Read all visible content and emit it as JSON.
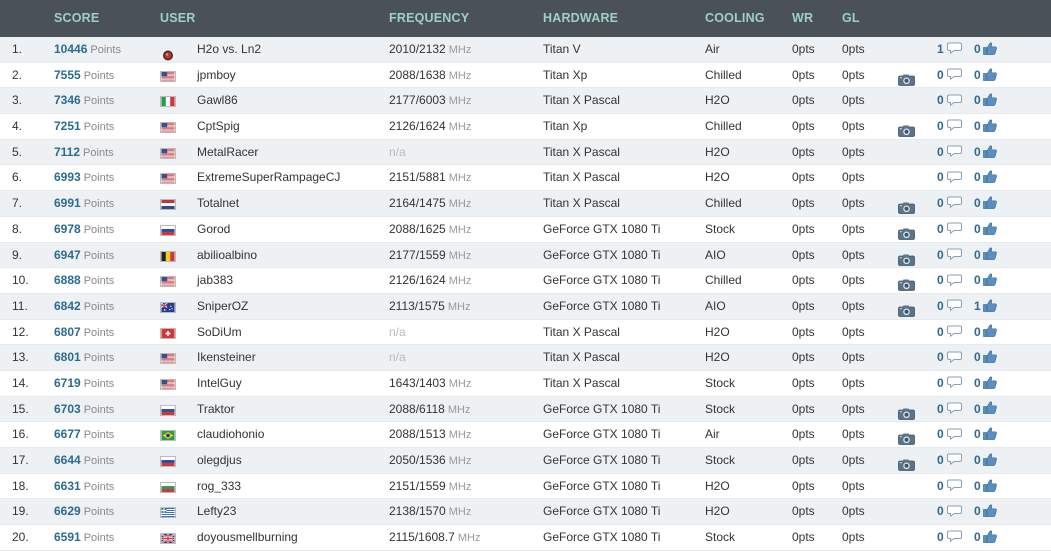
{
  "header": {
    "score": "SCORE",
    "user": "USER",
    "frequency": "FREQUENCY",
    "hardware": "HARDWARE",
    "cooling": "COOLING",
    "wr": "WR",
    "gl": "GL"
  },
  "units": {
    "points": "Points",
    "mhz": "MHz"
  },
  "colors": {
    "header_bg": "#4a5258",
    "header_text": "#9fd0c5",
    "score": "#2d6a8f",
    "row_alt": "#eef1f3"
  },
  "rows": [
    {
      "rank": "1.",
      "score": "10446",
      "flag": "ln2",
      "user": "H2o vs. Ln2",
      "freq": "2010/2132",
      "freq_na": false,
      "hardware": "Titan V",
      "cooling": "Air",
      "wr": "0pts",
      "gl": "0pts",
      "camera": false,
      "comments": "1",
      "likes": "0"
    },
    {
      "rank": "2.",
      "score": "7555",
      "flag": "us",
      "user": "jpmboy",
      "freq": "2088/1638",
      "freq_na": false,
      "hardware": "Titan Xp",
      "cooling": "Chilled",
      "wr": "0pts",
      "gl": "0pts",
      "camera": true,
      "comments": "0",
      "likes": "0"
    },
    {
      "rank": "3.",
      "score": "7346",
      "flag": "it",
      "user": "Gawl86",
      "freq": "2177/6003",
      "freq_na": false,
      "hardware": "Titan X Pascal",
      "cooling": "H2O",
      "wr": "0pts",
      "gl": "0pts",
      "camera": false,
      "comments": "0",
      "likes": "0"
    },
    {
      "rank": "4.",
      "score": "7251",
      "flag": "us",
      "user": "CptSpig",
      "freq": "2126/1624",
      "freq_na": false,
      "hardware": "Titan Xp",
      "cooling": "Chilled",
      "wr": "0pts",
      "gl": "0pts",
      "camera": true,
      "comments": "0",
      "likes": "0"
    },
    {
      "rank": "5.",
      "score": "7112",
      "flag": "us",
      "user": "MetalRacer",
      "freq": "n/a",
      "freq_na": true,
      "hardware": "Titan X Pascal",
      "cooling": "H2O",
      "wr": "0pts",
      "gl": "0pts",
      "camera": false,
      "comments": "0",
      "likes": "0"
    },
    {
      "rank": "6.",
      "score": "6993",
      "flag": "us",
      "user": "ExtremeSuperRampageCJ",
      "freq": "2151/5881",
      "freq_na": false,
      "hardware": "Titan X Pascal",
      "cooling": "H2O",
      "wr": "0pts",
      "gl": "0pts",
      "camera": false,
      "comments": "0",
      "likes": "0"
    },
    {
      "rank": "7.",
      "score": "6991",
      "flag": "nl",
      "user": "Totalnet",
      "freq": "2164/1475",
      "freq_na": false,
      "hardware": "Titan X Pascal",
      "cooling": "Chilled",
      "wr": "0pts",
      "gl": "0pts",
      "camera": true,
      "comments": "0",
      "likes": "0"
    },
    {
      "rank": "8.",
      "score": "6978",
      "flag": "ru",
      "user": "Gorod",
      "freq": "2088/1625",
      "freq_na": false,
      "hardware": "GeForce GTX 1080 Ti",
      "cooling": "Stock",
      "wr": "0pts",
      "gl": "0pts",
      "camera": true,
      "comments": "0",
      "likes": "0"
    },
    {
      "rank": "9.",
      "score": "6947",
      "flag": "be",
      "user": "abilioalbino",
      "freq": "2177/1559",
      "freq_na": false,
      "hardware": "GeForce GTX 1080 Ti",
      "cooling": "AIO",
      "wr": "0pts",
      "gl": "0pts",
      "camera": true,
      "comments": "0",
      "likes": "0"
    },
    {
      "rank": "10.",
      "score": "6888",
      "flag": "us",
      "user": "jab383",
      "freq": "2126/1624",
      "freq_na": false,
      "hardware": "GeForce GTX 1080 Ti",
      "cooling": "Chilled",
      "wr": "0pts",
      "gl": "0pts",
      "camera": true,
      "comments": "0",
      "likes": "0"
    },
    {
      "rank": "11.",
      "score": "6842",
      "flag": "au",
      "user": "SniperOZ",
      "freq": "2113/1575",
      "freq_na": false,
      "hardware": "GeForce GTX 1080 Ti",
      "cooling": "AIO",
      "wr": "0pts",
      "gl": "0pts",
      "camera": true,
      "comments": "0",
      "likes": "1"
    },
    {
      "rank": "12.",
      "score": "6807",
      "flag": "ch",
      "user": "SoDiUm",
      "freq": "n/a",
      "freq_na": true,
      "hardware": "Titan X Pascal",
      "cooling": "H2O",
      "wr": "0pts",
      "gl": "0pts",
      "camera": false,
      "comments": "0",
      "likes": "0"
    },
    {
      "rank": "13.",
      "score": "6801",
      "flag": "us",
      "user": "Ikensteiner",
      "freq": "n/a",
      "freq_na": true,
      "hardware": "Titan X Pascal",
      "cooling": "H2O",
      "wr": "0pts",
      "gl": "0pts",
      "camera": false,
      "comments": "0",
      "likes": "0"
    },
    {
      "rank": "14.",
      "score": "6719",
      "flag": "us",
      "user": "IntelGuy",
      "freq": "1643/1403",
      "freq_na": false,
      "hardware": "Titan X Pascal",
      "cooling": "Stock",
      "wr": "0pts",
      "gl": "0pts",
      "camera": false,
      "comments": "0",
      "likes": "0"
    },
    {
      "rank": "15.",
      "score": "6703",
      "flag": "ru",
      "user": "Traktor",
      "freq": "2088/6118",
      "freq_na": false,
      "hardware": "GeForce GTX 1080 Ti",
      "cooling": "Stock",
      "wr": "0pts",
      "gl": "0pts",
      "camera": true,
      "comments": "0",
      "likes": "0"
    },
    {
      "rank": "16.",
      "score": "6677",
      "flag": "br",
      "user": "claudiohonio",
      "freq": "2088/1513",
      "freq_na": false,
      "hardware": "GeForce GTX 1080 Ti",
      "cooling": "Air",
      "wr": "0pts",
      "gl": "0pts",
      "camera": true,
      "comments": "0",
      "likes": "0"
    },
    {
      "rank": "17.",
      "score": "6644",
      "flag": "ru",
      "user": "olegdjus",
      "freq": "2050/1536",
      "freq_na": false,
      "hardware": "GeForce GTX 1080 Ti",
      "cooling": "Stock",
      "wr": "0pts",
      "gl": "0pts",
      "camera": true,
      "comments": "0",
      "likes": "0"
    },
    {
      "rank": "18.",
      "score": "6631",
      "flag": "bg",
      "user": "rog_333",
      "freq": "2151/1559",
      "freq_na": false,
      "hardware": "GeForce GTX 1080 Ti",
      "cooling": "H2O",
      "wr": "0pts",
      "gl": "0pts",
      "camera": false,
      "comments": "0",
      "likes": "0"
    },
    {
      "rank": "19.",
      "score": "6629",
      "flag": "gr",
      "user": "Lefty23",
      "freq": "2138/1570",
      "freq_na": false,
      "hardware": "GeForce GTX 1080 Ti",
      "cooling": "H2O",
      "wr": "0pts",
      "gl": "0pts",
      "camera": false,
      "comments": "0",
      "likes": "0"
    },
    {
      "rank": "20.",
      "score": "6591",
      "flag": "gb",
      "user": "doyousmellburning",
      "freq": "2115/1608.7",
      "freq_na": false,
      "hardware": "GeForce GTX 1080 Ti",
      "cooling": "Stock",
      "wr": "0pts",
      "gl": "0pts",
      "camera": false,
      "comments": "0",
      "likes": "0"
    }
  ]
}
